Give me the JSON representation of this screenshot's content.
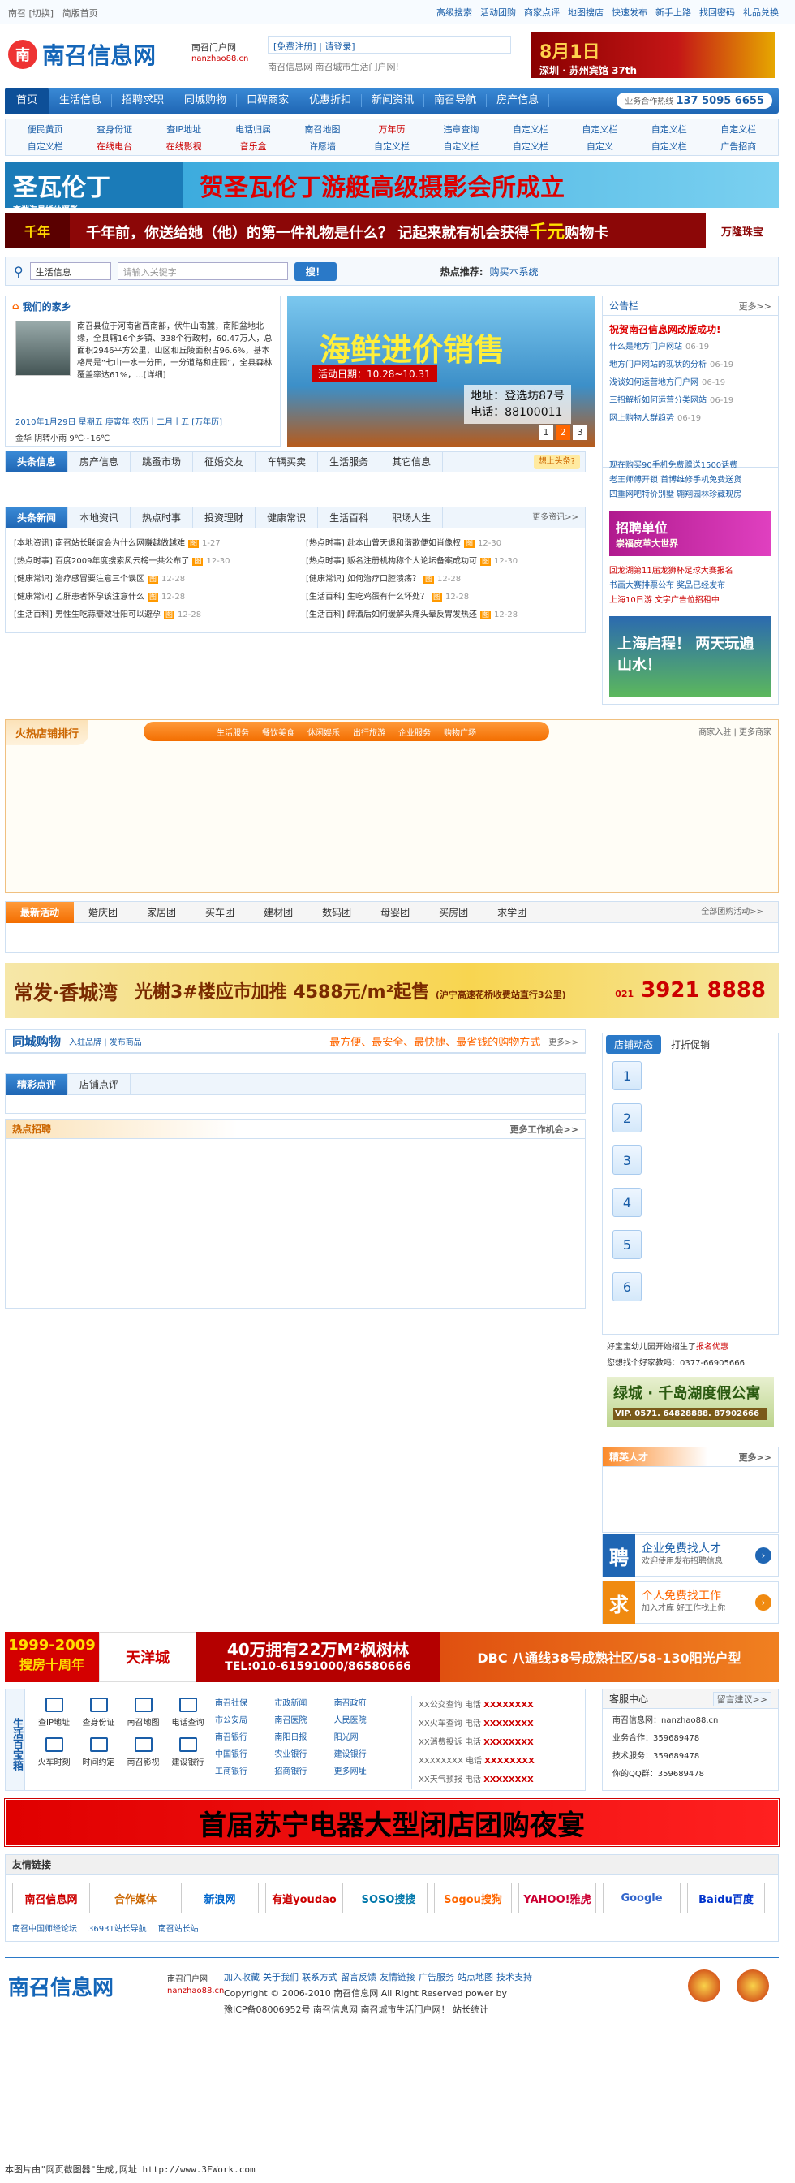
{
  "topbar": {
    "left": "南召 [切换] | 简版首页",
    "links": [
      "高级搜索",
      "活动团购",
      "商家点评",
      "地图搜店",
      "快速发布",
      "新手上路",
      "找回密码",
      "礼品兑换"
    ]
  },
  "header": {
    "logo_mark": "南",
    "logo_text": "南召信息网",
    "portal_label": "南召门户网",
    "portal_domain": "nanzhao88.cn",
    "register": "[免费注册] | 请登录]",
    "tagline": "南召信息网 南召城市生活门户网!",
    "ad_title": "8月1日",
    "ad_sub": "深圳 · 苏州宾馆 37th"
  },
  "nav": {
    "items": [
      "首页",
      "生活信息",
      "招聘求职",
      "同城购物",
      "口碑商家",
      "优惠折扣",
      "新闻资讯",
      "南召导航",
      "房产信息"
    ],
    "hotline_label": "业务合作热线",
    "hotline": "137 5095 6655"
  },
  "subnav": {
    "items": [
      {
        "t": "便民黄页",
        "c": ""
      },
      {
        "t": "查身份证",
        "c": ""
      },
      {
        "t": "查IP地址",
        "c": ""
      },
      {
        "t": "电话归属",
        "c": ""
      },
      {
        "t": "南召地图",
        "c": ""
      },
      {
        "t": "万年历",
        "c": "red"
      },
      {
        "t": "违章查询",
        "c": ""
      },
      {
        "t": "自定义栏",
        "c": ""
      },
      {
        "t": "自定义栏",
        "c": ""
      },
      {
        "t": "自定义栏",
        "c": ""
      },
      {
        "t": "自定义栏",
        "c": ""
      },
      {
        "t": "自定义栏",
        "c": ""
      },
      {
        "t": "在线电台",
        "c": "red"
      },
      {
        "t": "在线影视",
        "c": "red"
      },
      {
        "t": "音乐盒",
        "c": "red"
      },
      {
        "t": "许愿墙",
        "c": ""
      },
      {
        "t": "自定义栏",
        "c": ""
      },
      {
        "t": "自定义栏",
        "c": ""
      },
      {
        "t": "自定义栏",
        "c": ""
      },
      {
        "t": "自定义",
        "c": ""
      },
      {
        "t": "自定义栏",
        "c": ""
      },
      {
        "t": "广告招商",
        "c": ""
      }
    ]
  },
  "banner1": {
    "left": "圣瓦伦丁",
    "left_sub": "高端海景婚纱摄影",
    "main": "贺圣瓦伦丁游艇高级摄影会所成立"
  },
  "banner2": {
    "left": "千年",
    "main_pre": "千年前，你送给她（他）的第一件礼物是什么？ 记起来就有机会获得",
    "main_hl": "千元",
    "main_post": "购物卡",
    "right": "万隆珠宝"
  },
  "search": {
    "select": "生活信息",
    "placeholder": "请输入关键字",
    "button": "搜！",
    "hot_label": "热点推荐:",
    "hot_item": "购买本系统"
  },
  "home": {
    "title": "我们的家乡",
    "intro": "南召县位于河南省西南部，伏牛山南麓，南阳盆地北缘，全县辖16个乡镇、338个行政村，60.47万人，总面积2946平方公里，山区和丘陵面积占96.6%，基本格局是“七山一水一分田，一分道路和庄园”，全县森林覆盖率达61%，...[详细]",
    "date": "2010年1月29日  星期五  庚寅年  农历十二月十五  [万年历]",
    "weather": "金华  阴转小雨  9℃~16℃"
  },
  "seafood": {
    "title": "海鲜进价销售",
    "date": "活动日期：10.28~10.31",
    "addr": "地址：登选坊87号",
    "tel": "电话：88100011",
    "pages": [
      "1",
      "2",
      "3"
    ]
  },
  "notice": {
    "title": "公告栏",
    "more": "更多>>",
    "items": [
      {
        "t": "祝贺南召信息网改版成功!",
        "d": "",
        "first": true
      },
      {
        "t": "什么是地方门户网站",
        "d": "06-19"
      },
      {
        "t": "地方门户网站的现状的分析",
        "d": "06-19"
      },
      {
        "t": "浅谈如何运营地方门户网",
        "d": "06-19"
      },
      {
        "t": "三招解析如何运营分类网站",
        "d": "06-19"
      },
      {
        "t": "网上购物人群趋势",
        "d": "06-19"
      }
    ]
  },
  "tabs1": {
    "items": [
      "头条信息",
      "房产信息",
      "跳蚤市场",
      "征婚交友",
      "车辆买卖",
      "生活服务",
      "其它信息"
    ],
    "more": "想上头条?"
  },
  "news": {
    "tabs": [
      "头条新闻",
      "本地资讯",
      "热点时事",
      "投资理财",
      "健康常识",
      "生活百科",
      "职场人生"
    ],
    "more": "更多资讯>>",
    "left": [
      {
        "t": "[本地资讯] 南召站长联谊会为什么网赚越做越难",
        "d": "1-27"
      },
      {
        "t": "[热点时事] 百度2009年度搜索风云榜一共公布了",
        "d": "12-30"
      },
      {
        "t": "[健康常识] 治疗感冒要注意三个误区",
        "d": "12-28"
      },
      {
        "t": "[健康常识] 乙肝患者怀孕该注意什么",
        "d": "12-28"
      },
      {
        "t": "[生活百科] 男性生吃蒜瓣效壮阳可以避孕",
        "d": "12-28"
      }
    ],
    "right": [
      {
        "t": "[热点时事] 赴本山曾天退和谐歌便如肖像权",
        "d": "12-30"
      },
      {
        "t": "[热点时事] 贩名注册机构称个人论坛备案成功可",
        "d": "12-30"
      },
      {
        "t": "[健康常识] 如何治疗口腔溃疡？",
        "d": "12-28"
      },
      {
        "t": "[生活百科] 生吃鸡蛋有什么坏处？",
        "d": "12-28"
      },
      {
        "t": "[生活百科] 醉酒后如何缓解头痛头晕反胃发热还",
        "d": "12-28"
      }
    ]
  },
  "right1": {
    "items": [
      {
        "t": "现在购买90手机免费赠送1500话费",
        "c": ""
      },
      {
        "t": "老王师傅开锁  首博维修手机免费送货",
        "c": ""
      },
      {
        "t": "四重网吧特价别墅  翱翔园林珍藏现房",
        "c": ""
      }
    ],
    "ad1_title": "招聘单位",
    "ad1_sub": "崇福皮革大世界",
    "items2": [
      {
        "t": "回龙湖第11届龙狮杯足球大赛报名",
        "c": "red"
      },
      {
        "t": "书画大赛排票公布  奖品已经发布",
        "c": ""
      },
      {
        "t": "上海10日游  文字广告位招租中",
        "c": "red"
      }
    ],
    "ad2": "上海启程！ 两天玩遍山水！"
  },
  "hotshop": {
    "title": "火热店铺排行",
    "cats": [
      "生活服务",
      "餐饮美食",
      "休闲娱乐",
      "出行旅游",
      "企业服务",
      "购物广场"
    ],
    "links": "商家入驻 | 更多商家"
  },
  "group": {
    "tabs": [
      "最新活动",
      "婚庆团",
      "家居团",
      "买车团",
      "建材团",
      "数码团",
      "母婴团",
      "买房团",
      "求学团"
    ],
    "more": "全部团购活动>>"
  },
  "banner3": {
    "left": "常发·香城湾",
    "main": "光榭3#楼应市加推 4588元/m²起售",
    "main_sub": "(沪宁高速花桥收费站直行3公里)",
    "tel_pre": "021",
    "tel": "3921 8888"
  },
  "gouwu": {
    "title": "同城购物",
    "links": "入驻品牌 | 发布商品",
    "slogan": "最方便、最安全、最快捷、最省钱的购物方式",
    "more": "更多>>"
  },
  "dianping": {
    "tabs": [
      "精彩点评",
      "店铺点评"
    ]
  },
  "zhaopin": {
    "title": "热点招聘",
    "more": "更多工作机会>>"
  },
  "shopdyn": {
    "tab_on": "店铺动态",
    "tab_off": "打折促销",
    "nums": [
      "1",
      "2",
      "3",
      "4",
      "5",
      "6"
    ]
  },
  "right2": {
    "items": [
      {
        "t": "好宝宝幼儿园开始招生了",
        "hl": "报名优惠"
      },
      {
        "t": "您想找个好家教吗：0377-66905666",
        "hl": ""
      }
    ],
    "ad3_title": "绿城 · 千岛湖度假公寓",
    "ad3_tel": "VIP. 0571. 64828888. 87902666"
  },
  "talent": {
    "title": "精英人才",
    "more": "更多>>"
  },
  "job1": {
    "icon": "聘",
    "title": "企业免费找人才",
    "sub": "欢迎使用发布招聘信息",
    "go": "›"
  },
  "job2": {
    "icon": "求",
    "title": "个人免费找工作",
    "sub": "加入才库  好工作找上你",
    "go": "›"
  },
  "banner4": {
    "a": "1999-2009",
    "a_sub": "搜房十周年",
    "b": "天洋城",
    "c": "40万拥有22万M²枫树林",
    "c_sub": "TEL:010-61591000/86580666",
    "d": "DBC 八通线38号成熟社区/58-130阳光户型"
  },
  "life": {
    "side": "生活百宝箱",
    "icons": [
      "查IP地址",
      "查身份证",
      "南召地图",
      "电话查询",
      "火车时刻",
      "时间约定",
      "南召影视",
      "建设银行"
    ],
    "links": [
      "南召社保",
      "市政新闻",
      "南召政府",
      "市公安局",
      "南召医院",
      "人民医院",
      "南召银行",
      "南阳日报",
      "阳光网",
      "中国银行",
      "农业银行",
      "建设银行",
      "工商银行",
      "招商银行",
      "更多网址"
    ],
    "phones": [
      {
        "t": "XX公交查询  电话",
        "v": "XXXXXXXX"
      },
      {
        "t": "XX火车查询  电话",
        "v": "XXXXXXXX"
      },
      {
        "t": "XX消费投诉  电话",
        "v": "XXXXXXXX"
      },
      {
        "t": "XXXXXXXX  电话",
        "v": "XXXXXXXX"
      },
      {
        "t": "XX天气预报  电话",
        "v": "XXXXXXXX"
      }
    ]
  },
  "service": {
    "title": "客服中心",
    "more": "留言建议>>",
    "items": [
      "南召信息网：nanzhao88.cn",
      "业务合作：359689478",
      "技术服务：359689478",
      "你的QQ群：359689478"
    ]
  },
  "banner5": {
    "text": "首届苏宁电器大型闭店团购夜宴"
  },
  "friends": {
    "title": "友情链接",
    "logos": [
      "南召信息网",
      "合作媒体",
      "新浪网",
      "有道youdao",
      "SOSO搜搜",
      "Sogou搜狗",
      "YAHOO!雅虎",
      "Google",
      "Baidu百度"
    ],
    "texts": [
      "南召中国师经论坛",
      "36931站长导航",
      "南召站长站"
    ]
  },
  "footer": {
    "logo": "南召信息网",
    "portal": "南召门户网",
    "domain": "nanzhao88.cn",
    "links": [
      "加入收藏",
      "关于我们",
      "联系方式",
      "留言反馈",
      "友情链接",
      "广告服务",
      "站点地图",
      "技术支持"
    ],
    "copy": "Copyright © 2006-2010  南召信息网  All Right Reserved power by",
    "icp": "豫ICP备08006952号  南召信息网  南召城市生活门户网！  站长统计"
  },
  "capture": "本图片由\"网页截图器\"生成,网址 http://www.3FWork.com"
}
